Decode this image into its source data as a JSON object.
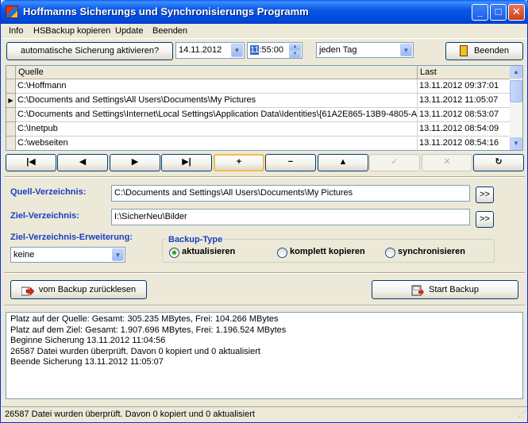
{
  "window": {
    "title": "Hoffmanns Sicherungs und Synchronisierungs Programm",
    "controls": {
      "minimize": "_",
      "maximize": "□",
      "close": "✕"
    }
  },
  "menu": [
    "Info",
    "HSBackup kopieren",
    "Update",
    "Beenden"
  ],
  "toolbar": {
    "auto_backup_label": "automatische Sicherung aktivieren?",
    "date_value": "14.11.2012",
    "time_selected": "11",
    "time_rest": ":55:00",
    "interval_value": "jeden Tag",
    "quit_label": "Beenden"
  },
  "grid": {
    "columns": [
      "Quelle",
      "Last"
    ],
    "rows": [
      {
        "source": "C:\\Hoffmann",
        "last": "13.11.2012 09:37:01",
        "current": false
      },
      {
        "source": "C:\\Documents and Settings\\All Users\\Documents\\My Pictures",
        "last": "13.11.2012 11:05:07",
        "current": true
      },
      {
        "source": "C:\\Documents and Settings\\Internet\\Local Settings\\Application Data\\Identities\\{61A2E865-13B9-4805-A",
        "last": "13.11.2012 08:53:07",
        "current": false
      },
      {
        "source": "C:\\Inetpub",
        "last": "13.11.2012 08:54:09",
        "current": false
      },
      {
        "source": "C:\\webseiten",
        "last": "13.11.2012 08:54:16",
        "current": false
      }
    ]
  },
  "navigator": {
    "first": "|◀",
    "prior": "◀",
    "next": "▶",
    "last": "▶|",
    "insert": "+",
    "delete": "−",
    "edit": "▲",
    "post": "✓",
    "cancel": "✕",
    "refresh": "↻"
  },
  "form": {
    "source_dir_label": "Quell-Verzeichnis:",
    "source_dir_value": "C:\\Documents and Settings\\All Users\\Documents\\My Pictures",
    "target_dir_label": "Ziel-Verzeichnis:",
    "target_dir_value": "I:\\SicherNeu\\Bilder",
    "browse_label": ">>",
    "extension_label": "Ziel-Verzeichnis-Erweiterung:",
    "extension_value": "keine",
    "backup_type_label": "Backup-Type",
    "backup_types": [
      {
        "label": "aktualisieren",
        "selected": true
      },
      {
        "label": "komplett kopieren",
        "selected": false
      },
      {
        "label": "synchronisieren",
        "selected": false
      }
    ]
  },
  "actions": {
    "restore_label": "vom Backup zurücklesen",
    "start_label": "Start Backup"
  },
  "log": [
    "Platz auf der Quelle: Gesamt: 305.235 MBytes, Frei: 104.266 MBytes",
    "Platz auf dem Ziel: Gesamt: 1.907.696 MBytes, Frei: 1.196.524 MBytes",
    "Beginne Sicherung 13.11.2012 11:04:56",
    "26587 Datei wurden überprüft. Davon 0 kopiert und 0 aktualisiert",
    "Beende Sicherung 13.11.2012 11:05:07"
  ],
  "status_text": "26587 Datei wurden überprüft. Davon 0 kopiert und 0 aktualisiert",
  "colors": {
    "titlebar": "#0a5ae6",
    "label_blue": "#1a3ec1",
    "radio_dot": "#21a121"
  }
}
